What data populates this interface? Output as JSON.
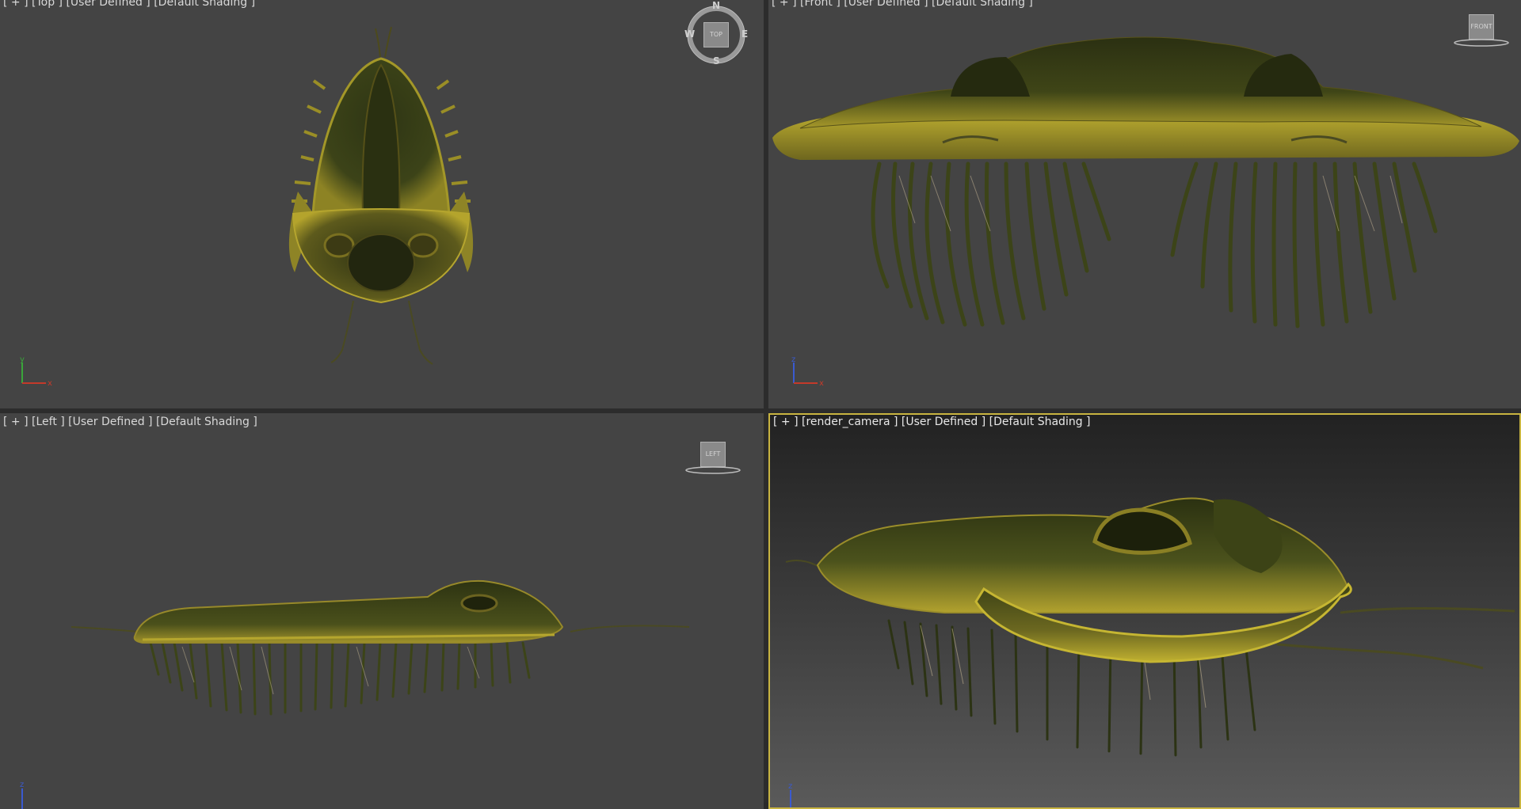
{
  "viewports": {
    "top": {
      "label": "[ + ] [Top ] [User Defined ] [Default Shading ]"
    },
    "front": {
      "label": "[ + ] [Front ] [User Defined ] [Default Shading ]"
    },
    "left": {
      "label": "[ + ] [Left ] [User Defined ] [Default Shading ]"
    },
    "camera": {
      "label": "[ + ] [render_camera ] [User Defined ] [Default Shading ]"
    }
  },
  "viewcube": {
    "top_face": "TOP",
    "front_face": "FRONT",
    "left_face": "LEFT",
    "compass": {
      "north": "N",
      "south": "S",
      "east": "E",
      "west": "W"
    }
  },
  "axes": {
    "top": {
      "a": "y",
      "b": "x"
    },
    "front": {
      "a": "z",
      "b": "x"
    },
    "left": {
      "a": "z"
    },
    "camera": {
      "a": "z"
    }
  },
  "colors": {
    "viewport_bg": "#444444",
    "active_border": "#c8b440",
    "model_yellow": "#a7992a",
    "model_dark": "#2c3112",
    "axis_x": "#c43a2a",
    "axis_y": "#3aa53a",
    "axis_z": "#3a5ad0"
  },
  "model": {
    "name": "trilobite"
  }
}
